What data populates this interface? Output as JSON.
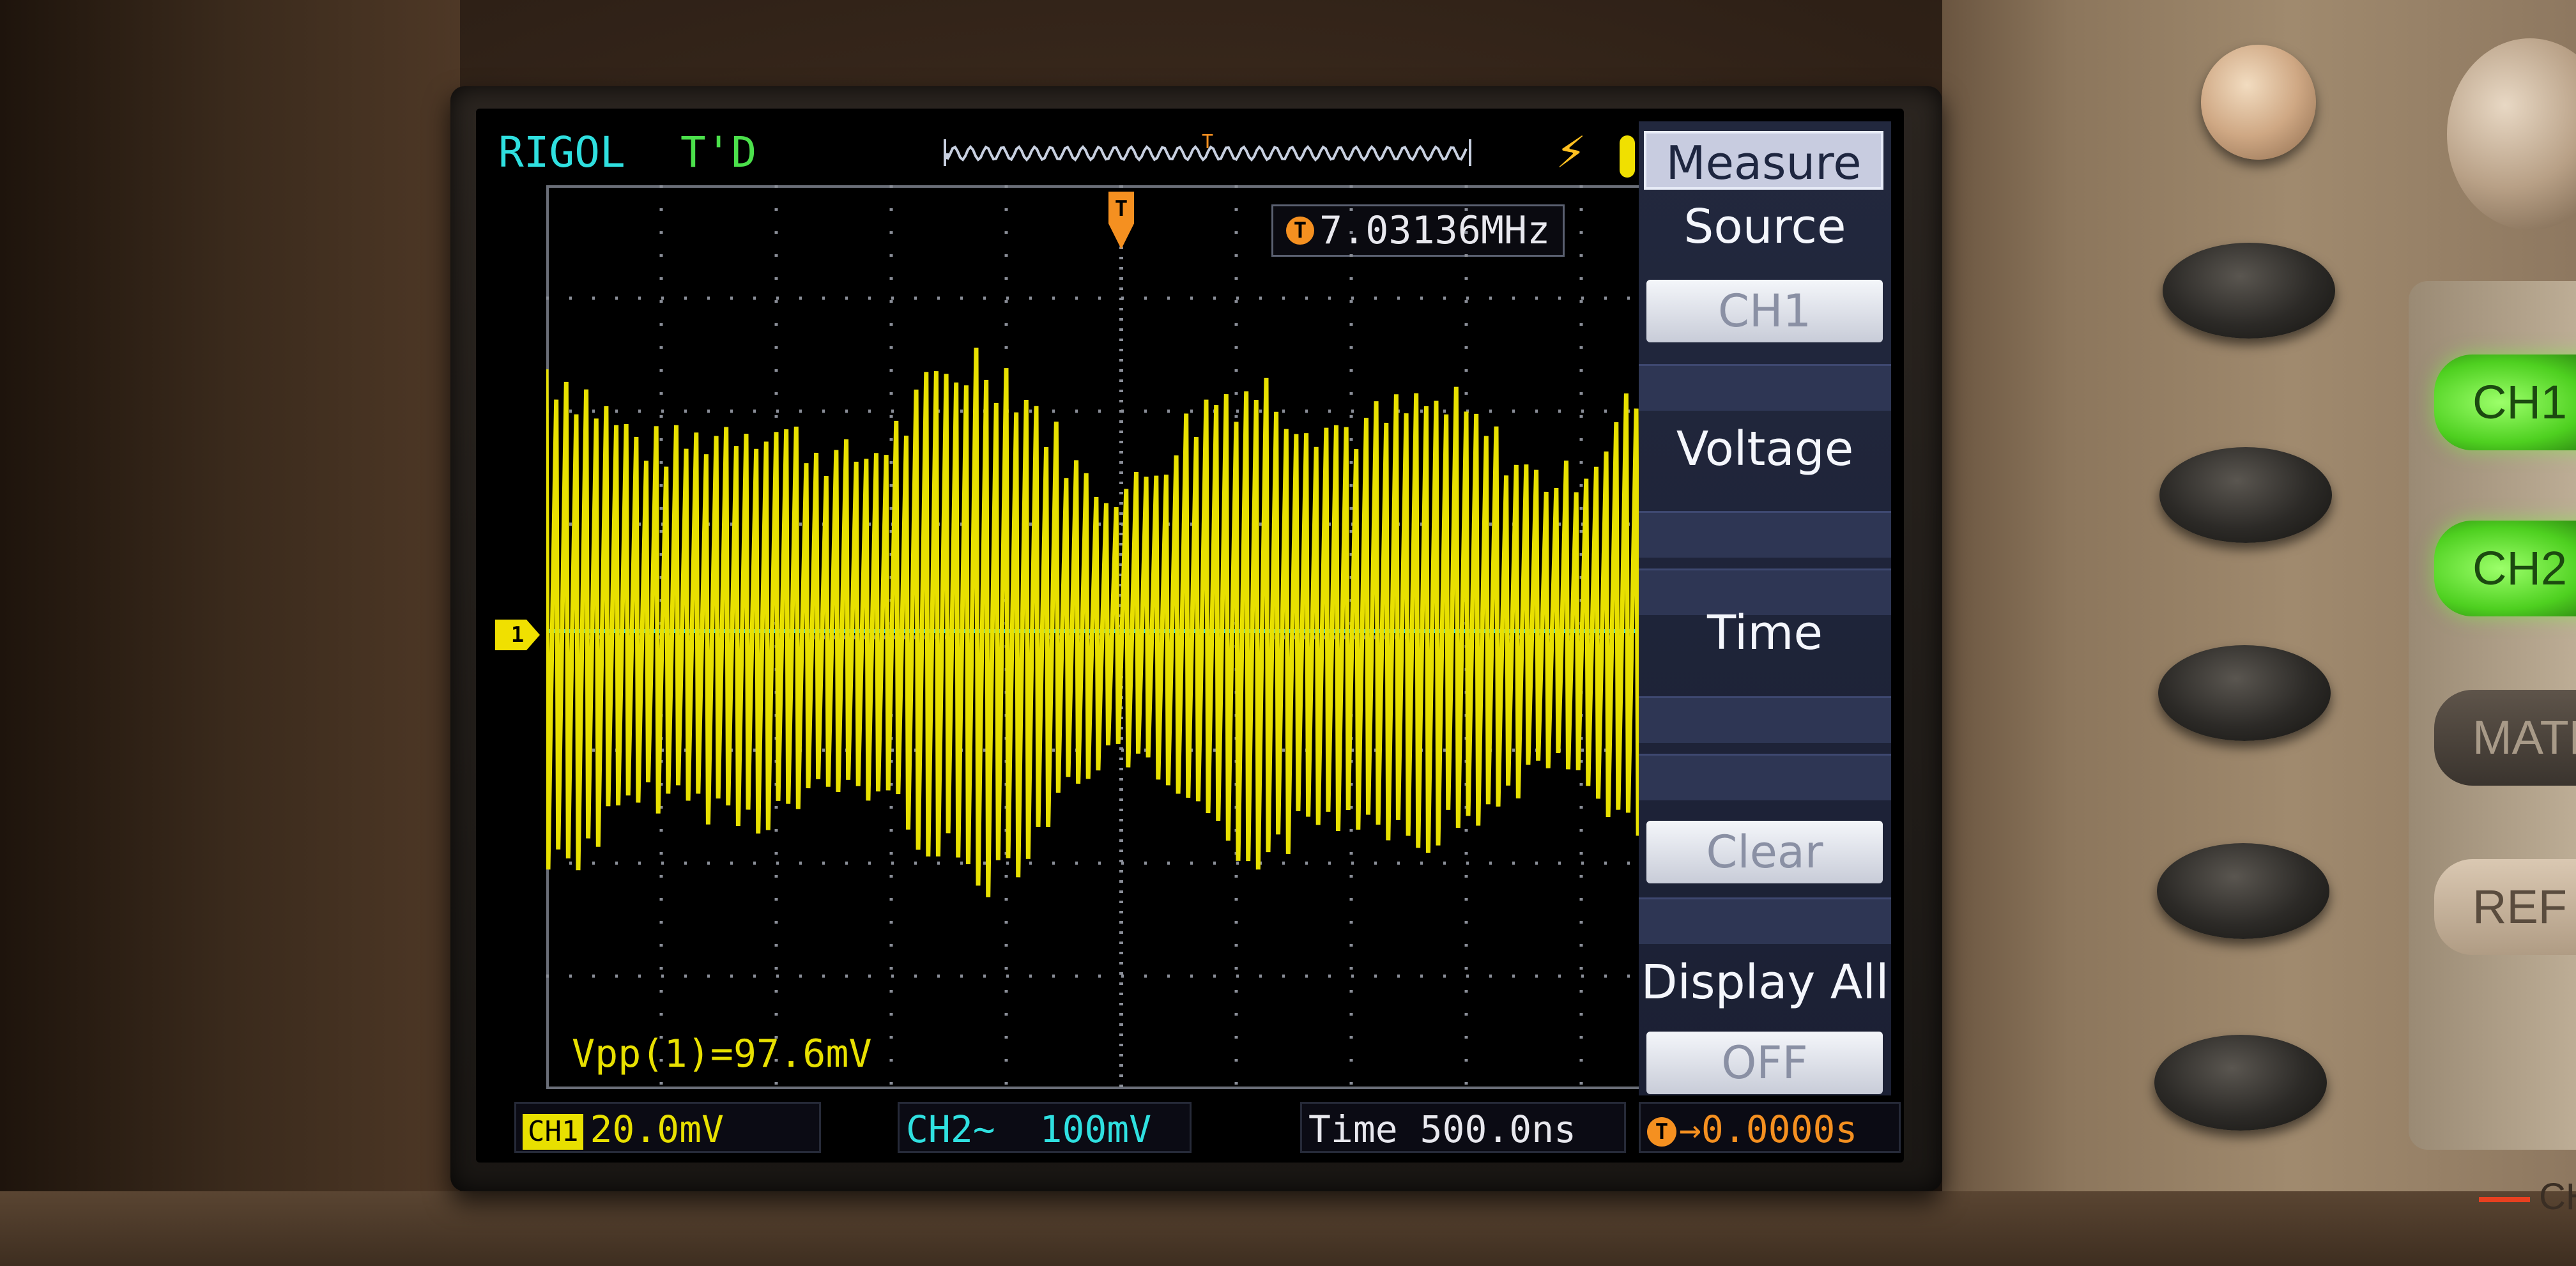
{
  "screen": {
    "brand": "RIGOL",
    "trigger_status": "T'D",
    "trigger_marker": "T",
    "frequency_readout": "7.03136MHz",
    "vpp_measurement": "Vpp(1)=97.6mV",
    "ch1_marker": "1"
  },
  "status_bar": {
    "ch1_tag": "CH1",
    "ch1_scale": "20.0mV",
    "ch2_label": "CH2~",
    "ch2_scale": "100mV",
    "time_label": "Time",
    "time_scale": "500.0ns",
    "trigger_offset": "0.0000s"
  },
  "soft_menu": {
    "title": "Measure",
    "source_label": "Source",
    "source_value": "CH1",
    "voltage_label": "Voltage",
    "time_label": "Time",
    "clear_label": "Clear",
    "display_all_label": "Display All",
    "display_all_value": "OFF"
  },
  "panel": {
    "ch1_button": "CH1",
    "ch2_button": "CH2",
    "math_button": "MATH",
    "ref_button": "REF",
    "footer_label": "CH"
  },
  "colors": {
    "ch1_trace": "#e8e000",
    "ch2_trace": "#2fe0e0",
    "trigger": "#f59020",
    "menu_bg": "#1b2034"
  },
  "waveform": {
    "channel": "CH1",
    "frequency": "7.03136MHz",
    "vpp": "97.6mV",
    "vertical_scale": "20.0mV",
    "timebase": "500.0ns"
  }
}
